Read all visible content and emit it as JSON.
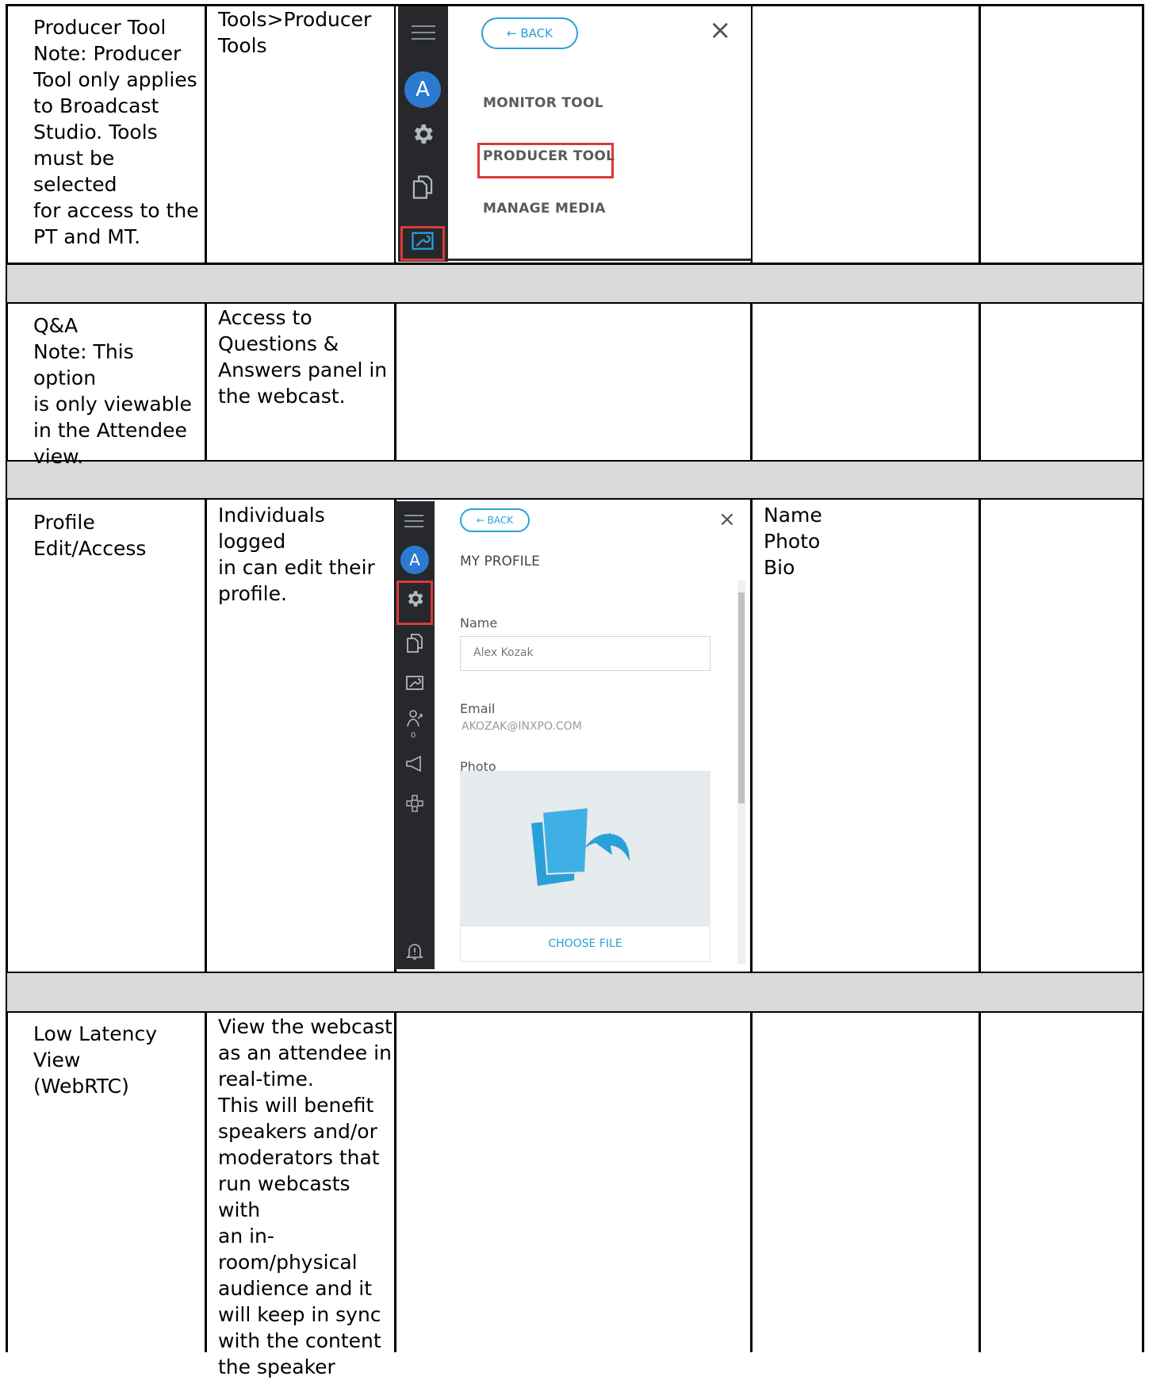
{
  "rows": [
    {
      "feature": "Producer Tool\nNote: Producer\nTool only applies\nto Broadcast\nStudio. Tools\nmust be selected\nfor access to the\nPT and MT.",
      "description": "Tools>Producer\nTools"
    },
    {
      "feature": "Q&A\nNote: This option\nis only viewable\nin the Attendee\nview.",
      "description": "Access to\nQuestions &\nAnswers panel in\nthe webcast."
    },
    {
      "feature": "Profile\nEdit/Access",
      "description": "Individuals logged\nin can edit their\nprofile.",
      "fields": "Name\nPhoto\nBio"
    },
    {
      "feature": "Low Latency View\n(WebRTC)",
      "description": "View the webcast\nas an attendee in\nreal-time.\nThis will benefit\nspeakers and/or\nmoderators that\nrun webcasts with\nan in-\nroom/physical\naudience and it\nwill keep in sync\nwith the content\nthe speaker"
    }
  ],
  "tools_menu": {
    "avatar_letter": "A",
    "back_label": "← BACK",
    "close_glyph": "×",
    "items": [
      "MONITOR TOOL",
      "PRODUCER TOOL",
      "MANAGE MEDIA"
    ],
    "highlighted_item": "PRODUCER TOOL",
    "highlight_color": "#d93a3a"
  },
  "profile_panel": {
    "avatar_letter": "A",
    "back_label": "← BACK",
    "close_glyph": "×",
    "title": "MY PROFILE",
    "name_label": "Name",
    "name_value": "Alex Kozak",
    "email_label": "Email",
    "email_value": "AKOZAK@INXPO.COM",
    "photo_label": "Photo",
    "choose_file_label": "CHOOSE FILE",
    "badge_count": "0",
    "accent_color": "#2aa0d8",
    "rail_color": "#26282c"
  }
}
